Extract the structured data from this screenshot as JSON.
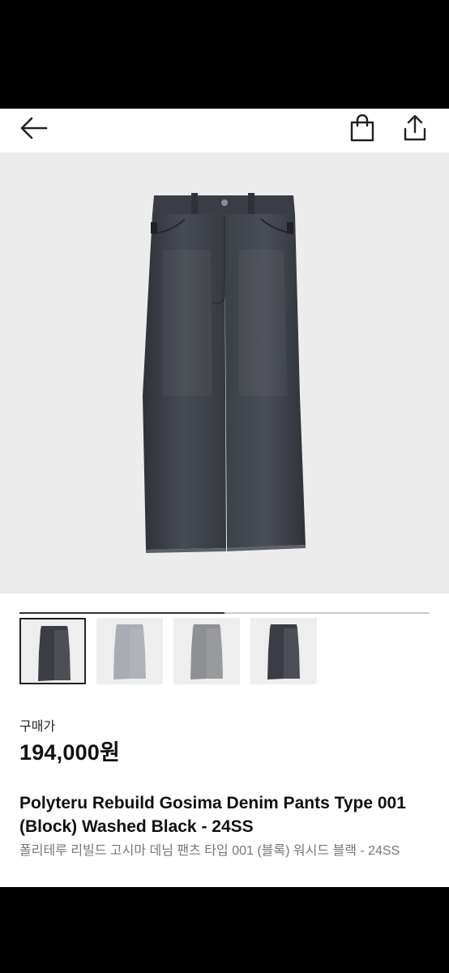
{
  "header": {
    "back_icon": "arrow-left-icon",
    "bag_icon": "shopping-bag-icon",
    "share_icon": "share-icon"
  },
  "gallery": {
    "progress": 0.5,
    "thumbnails": [
      {
        "variant": "black",
        "selected": true
      },
      {
        "variant": "light-gray",
        "selected": false
      },
      {
        "variant": "gray",
        "selected": false
      },
      {
        "variant": "black",
        "selected": false
      }
    ]
  },
  "product": {
    "price_label": "구매가",
    "price": "194,000원",
    "title": "Polyteru Rebuild Gosima Denim Pants Type 001 (Block) Washed Black - 24SS",
    "subtitle": "폴리테루 리빌드 고시마 데님 팬츠 타입 001 (블록) 워시드 블랙 - 24SS"
  },
  "colors": {
    "denim_black": "#3a3d44",
    "denim_light": "#a9adb3",
    "denim_gray": "#8e9094"
  }
}
